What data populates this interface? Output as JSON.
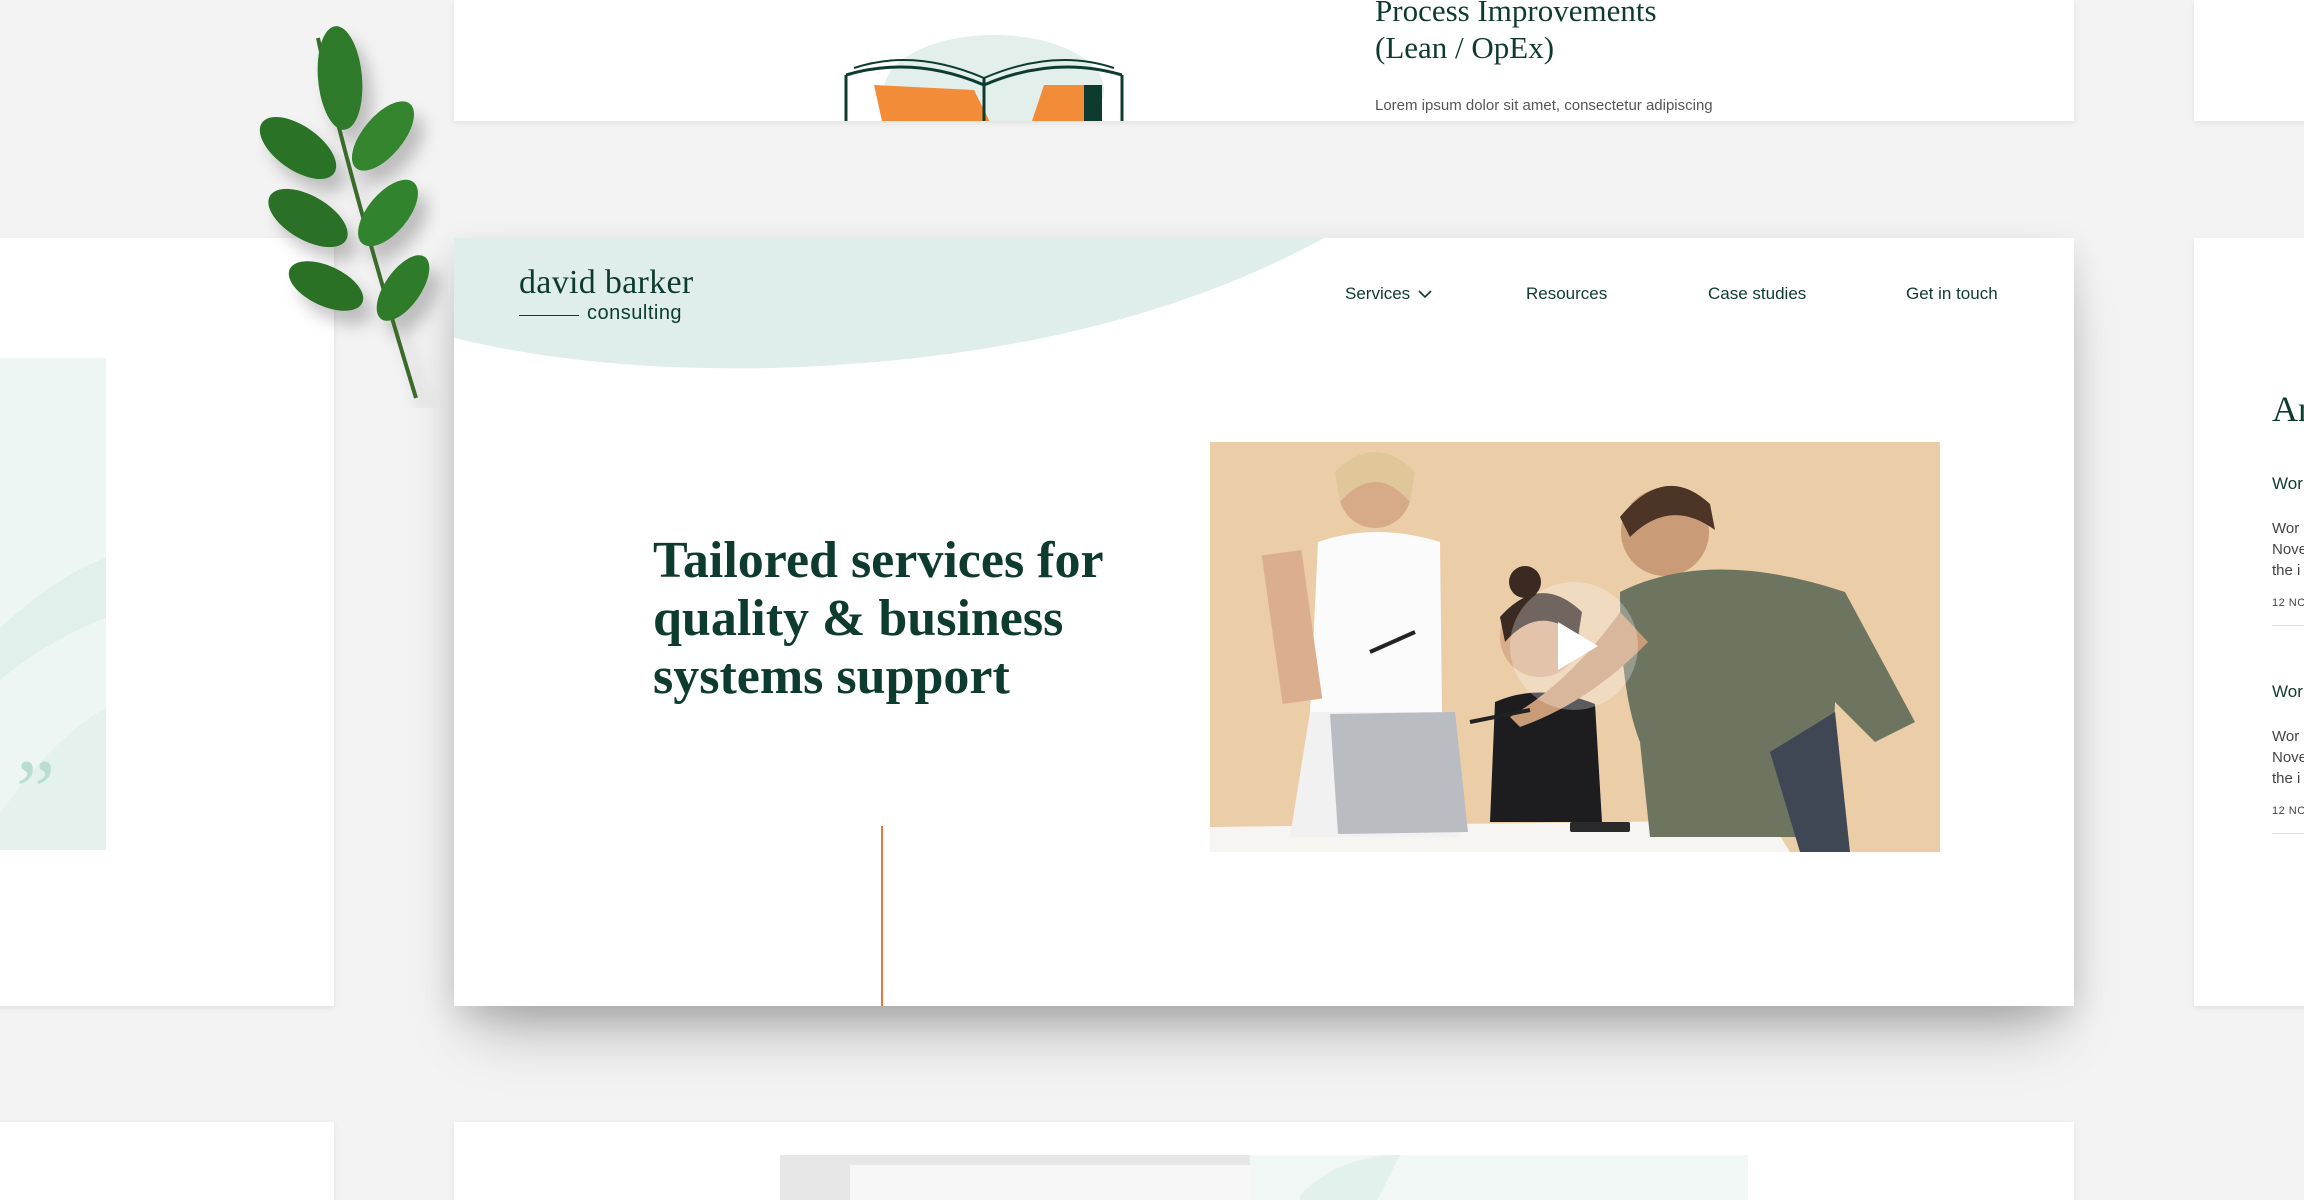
{
  "top_card": {
    "title_line1": "Process Improvements",
    "title_line2": "(Lean / OpEx)",
    "body_text": "Lorem ipsum dolor sit amet, consectetur adipiscing"
  },
  "logo": {
    "name": "david barker",
    "sub": "consulting"
  },
  "nav": {
    "services": "Services",
    "resources": "Resources",
    "case_studies": "Case studies",
    "get_in_touch": "Get in touch"
  },
  "hero": {
    "title": "Tailored services for quality & business systems support"
  },
  "left_card": {
    "quote_mark": "”"
  },
  "right_card": {
    "heading": "Ar",
    "items": [
      {
        "title": "Wor",
        "text_lines": [
          "Wor",
          "Nove",
          "the i"
        ],
        "date": "12 NO"
      },
      {
        "title": "Wor",
        "text_lines": [
          "Wor",
          "Nove",
          "the i"
        ],
        "date": "12 NO"
      }
    ]
  },
  "colors": {
    "brand_green": "#0e3b30",
    "mint": "#dfeeea",
    "accent_orange": "#e8763a",
    "background": "#f3f3f3"
  },
  "icons": {
    "services_dropdown": "chevron-down-icon",
    "video_play": "play-icon",
    "decor_leaf": "leaf-icon",
    "book": "book-icon"
  }
}
